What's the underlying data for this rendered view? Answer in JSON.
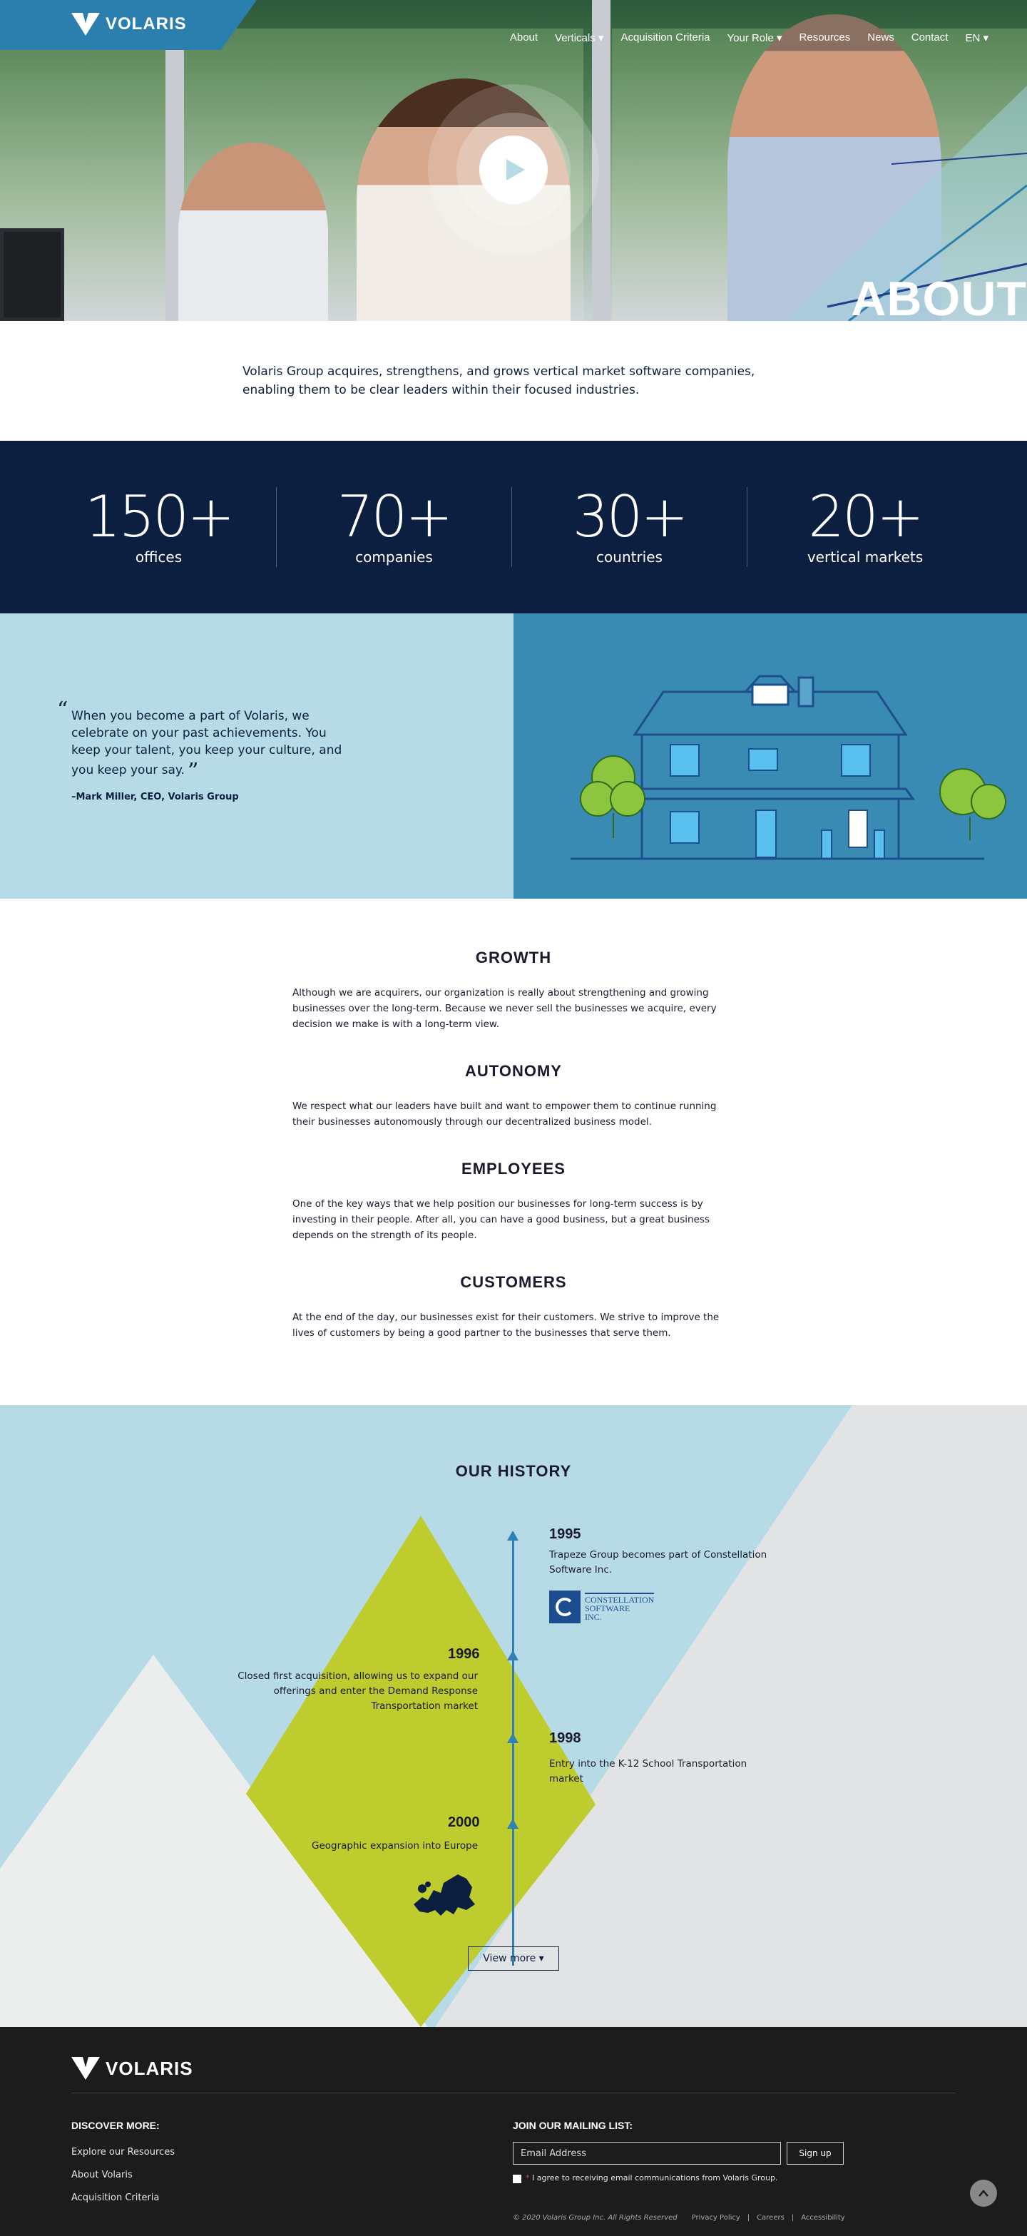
{
  "brand": {
    "name": "VOLARIS",
    "colors": {
      "primary": "#2b7fae",
      "navy": "#0c1f40",
      "light_blue": "#b6dbe6",
      "lime": "#bfcc2d",
      "footer": "#1c1c1d"
    }
  },
  "nav": {
    "items": [
      {
        "label": "About",
        "icon": ""
      },
      {
        "label": "Verticals",
        "icon": "caret-down"
      },
      {
        "label": "Acquisition Criteria",
        "icon": ""
      },
      {
        "label": "Your Role",
        "icon": "caret-down"
      },
      {
        "label": "Resources",
        "icon": ""
      },
      {
        "label": "News",
        "icon": ""
      },
      {
        "label": "Contact",
        "icon": ""
      },
      {
        "label": "EN",
        "icon": "caret-down"
      }
    ]
  },
  "hero": {
    "title": "ABOUT"
  },
  "intro": {
    "text": "Volaris Group acquires, strengthens, and grows vertical market software companies, enabling them to be clear leaders within their focused industries."
  },
  "stats": [
    {
      "value": "150+",
      "label": "offices"
    },
    {
      "value": "70+",
      "label": "companies"
    },
    {
      "value": "30+",
      "label": "countries"
    },
    {
      "value": "20+",
      "label": "vertical markets"
    }
  ],
  "quote": {
    "text": "When you become a part of Volaris, we celebrate on your past achievements. You keep your talent, you keep your culture, and you keep your say.",
    "attribution": "–Mark Miller, CEO, Volaris Group",
    "open_mark": "“",
    "close_mark": "”"
  },
  "values": [
    {
      "heading": "GROWTH",
      "text": "Although we are acquirers, our organization is really about strengthening and growing businesses over the long-term. Because we never sell the businesses we acquire, every decision we make is with a long-term view."
    },
    {
      "heading": "AUTONOMY",
      "text": "We respect what our leaders have built and want to empower them to continue running their businesses autonomously through our decentralized business model."
    },
    {
      "heading": "EMPLOYEES",
      "text": "One of the key ways that we help position our businesses for long-term success is by investing in their people. After all, you can have a good business, but a great business depends on the strength of its people."
    },
    {
      "heading": "CUSTOMERS",
      "text": "At the end of the day, our businesses exist for their customers. We strive to improve the lives of customers by being a good partner to the businesses that serve them."
    }
  ],
  "history": {
    "title": "OUR HISTORY",
    "events": [
      {
        "year": "1995",
        "text": "Trapeze Group becomes part of Constellation Software Inc.",
        "side": "right"
      },
      {
        "year": "1996",
        "text": "Closed first acquisition, allowing us to expand our offerings and enter the Demand Response Transportation market",
        "side": "left"
      },
      {
        "year": "1998",
        "text": "Entry into the K-12 School Transportation market",
        "side": "right"
      },
      {
        "year": "2000",
        "text": "Geographic expansion into Europe",
        "side": "left"
      }
    ],
    "constellation_logo": {
      "line1": "CONSTELLATION",
      "line2": "SOFTWARE",
      "line3": "INC."
    },
    "view_more": "View more"
  },
  "footer": {
    "discover_title": "DISCOVER MORE:",
    "links": [
      "Explore our Resources",
      "About Volaris",
      "Acquisition Criteria"
    ],
    "mailing_title": "JOIN OUR MAILING LIST:",
    "email_placeholder": "Email Address",
    "signup": "Sign up",
    "agree_marker": "*",
    "agree": "I agree to receiving email communications from Volaris Group.",
    "copyright": "© 2020 Volaris Group Inc. All Rights Reserved",
    "legal_links": [
      "Privacy Policy",
      "Careers",
      "Accessibility"
    ],
    "separator": "|"
  }
}
